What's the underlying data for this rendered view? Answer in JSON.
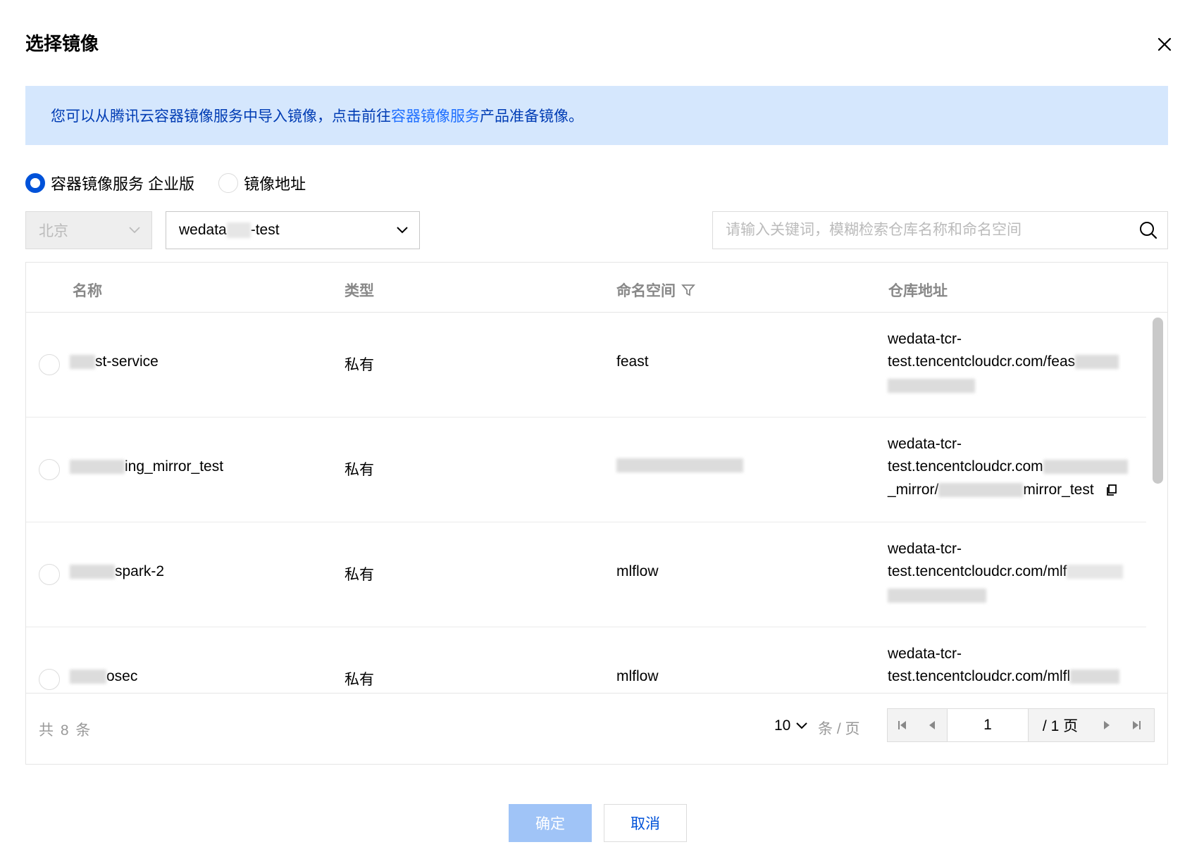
{
  "dialog": {
    "title": "选择镜像",
    "close_icon": "close-icon"
  },
  "notice": {
    "text_before": "您可以从腾讯云容器镜像服务中导入镜像，点击前往",
    "link": "容器镜像服务",
    "text_after": "产品准备镜像。"
  },
  "source": {
    "options": [
      {
        "label": "容器镜像服务 企业版",
        "checked": true
      },
      {
        "label": "镜像地址",
        "checked": false
      }
    ]
  },
  "filters": {
    "region": "北京",
    "instance_prefix": "wedata",
    "instance_suffix": "-test",
    "search_placeholder": "请输入关键词，模糊检索仓库名称和命名空间"
  },
  "table": {
    "columns": [
      "名称",
      "类型",
      "命名空间",
      "仓库地址"
    ],
    "rows": [
      {
        "name_suffix": "st-service",
        "type": "私有",
        "namespace": "feast",
        "addr1": "wedata-tcr-",
        "addr2": "test.tencentcloudcr.com/feas",
        "addr3": ""
      },
      {
        "name_suffix": "ing_mirror_test",
        "type": "私有",
        "namespace": "",
        "addr1": "wedata-tcr-",
        "addr2": "test.tencentcloudcr.com",
        "addr3_prefix": "_mirror/",
        "addr3_suffix": "mirror_test"
      },
      {
        "name_suffix": "spark-2",
        "type": "私有",
        "namespace": "mlflow",
        "addr1": "wedata-tcr-",
        "addr2": "test.tencentcloudcr.com/mlf",
        "addr3": ""
      },
      {
        "name_suffix": "osec",
        "type": "私有",
        "namespace": "mlflow",
        "addr1": "wedata-tcr-",
        "addr2": "test.tencentcloudcr.com/mlfl",
        "addr3": ""
      }
    ]
  },
  "pagination": {
    "total": "共 8 条",
    "page_size": "10",
    "per_page": "条 / 页",
    "current_page": "1",
    "total_pages": "/ 1 页"
  },
  "actions": {
    "ok": "确定",
    "cancel": "取消"
  },
  "colors": {
    "primary": "#0052d9",
    "notice_bg": "#d5e7fd",
    "ok_disabled": "#a0c4f7"
  }
}
